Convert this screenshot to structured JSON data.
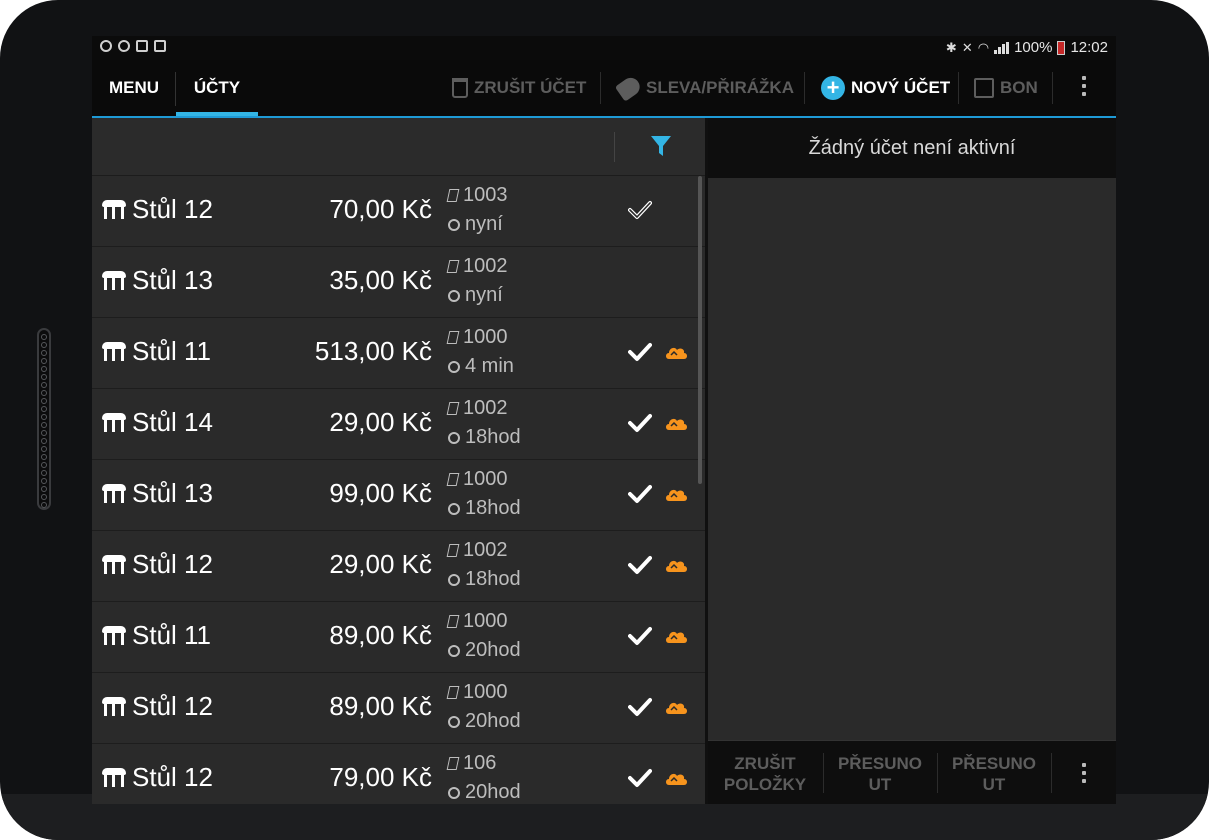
{
  "statusbar": {
    "battery": "100%",
    "time": "12:02"
  },
  "actionbar": {
    "tabs": [
      {
        "label": "MENU",
        "active": false
      },
      {
        "label": "ÚČTY",
        "active": true
      }
    ],
    "actions": {
      "cancel_bill": {
        "label": "ZRUŠIT ÚČET",
        "enabled": false,
        "icon": "trash-icon"
      },
      "discount": {
        "label": "SLEVA/PŘIRÁŽKA",
        "enabled": false,
        "icon": "discount-tag-icon"
      },
      "new_bill": {
        "label": "NOVÝ ÚČET",
        "enabled": true,
        "icon": "plus-circle-icon"
      },
      "bon": {
        "label": "BON",
        "enabled": false,
        "icon": "bon-icon"
      }
    }
  },
  "bills": [
    {
      "table": "Stůl 12",
      "amount": "70,00 Kč",
      "number": "1003",
      "time": "nyní",
      "status": "check-outline",
      "synced": false
    },
    {
      "table": "Stůl 13",
      "amount": "35,00 Kč",
      "number": "1002",
      "time": "nyní",
      "status": "none",
      "synced": false
    },
    {
      "table": "Stůl 11",
      "amount": "513,00 Kč",
      "number": "1000",
      "time": "4 min",
      "status": "check",
      "synced": true
    },
    {
      "table": "Stůl 14",
      "amount": "29,00 Kč",
      "number": "1002",
      "time": "18hod",
      "status": "check",
      "synced": true
    },
    {
      "table": "Stůl 13",
      "amount": "99,00 Kč",
      "number": "1000",
      "time": "18hod",
      "status": "check",
      "synced": true
    },
    {
      "table": "Stůl 12",
      "amount": "29,00 Kč",
      "number": "1002",
      "time": "18hod",
      "status": "check",
      "synced": true
    },
    {
      "table": "Stůl 11",
      "amount": "89,00 Kč",
      "number": "1000",
      "time": "20hod",
      "status": "check",
      "synced": true
    },
    {
      "table": "Stůl 12",
      "amount": "89,00 Kč",
      "number": "1000",
      "time": "20hod",
      "status": "check",
      "synced": true
    },
    {
      "table": "Stůl 12",
      "amount": "79,00 Kč",
      "number": "106",
      "time": "20hod",
      "status": "check",
      "synced": true
    }
  ],
  "detail": {
    "empty_text": "Žádný účet není aktivní",
    "footer": {
      "cancel_items": "ZRUŠIT POLOŽKY",
      "move_1": "PŘESUNO UT",
      "move_2": "PŘESUNO UT"
    }
  },
  "colors": {
    "accent": "#33b5e5",
    "cloud": "#f7941d",
    "panel": "#2a2a2a",
    "disabled": "#5d5d5d"
  }
}
